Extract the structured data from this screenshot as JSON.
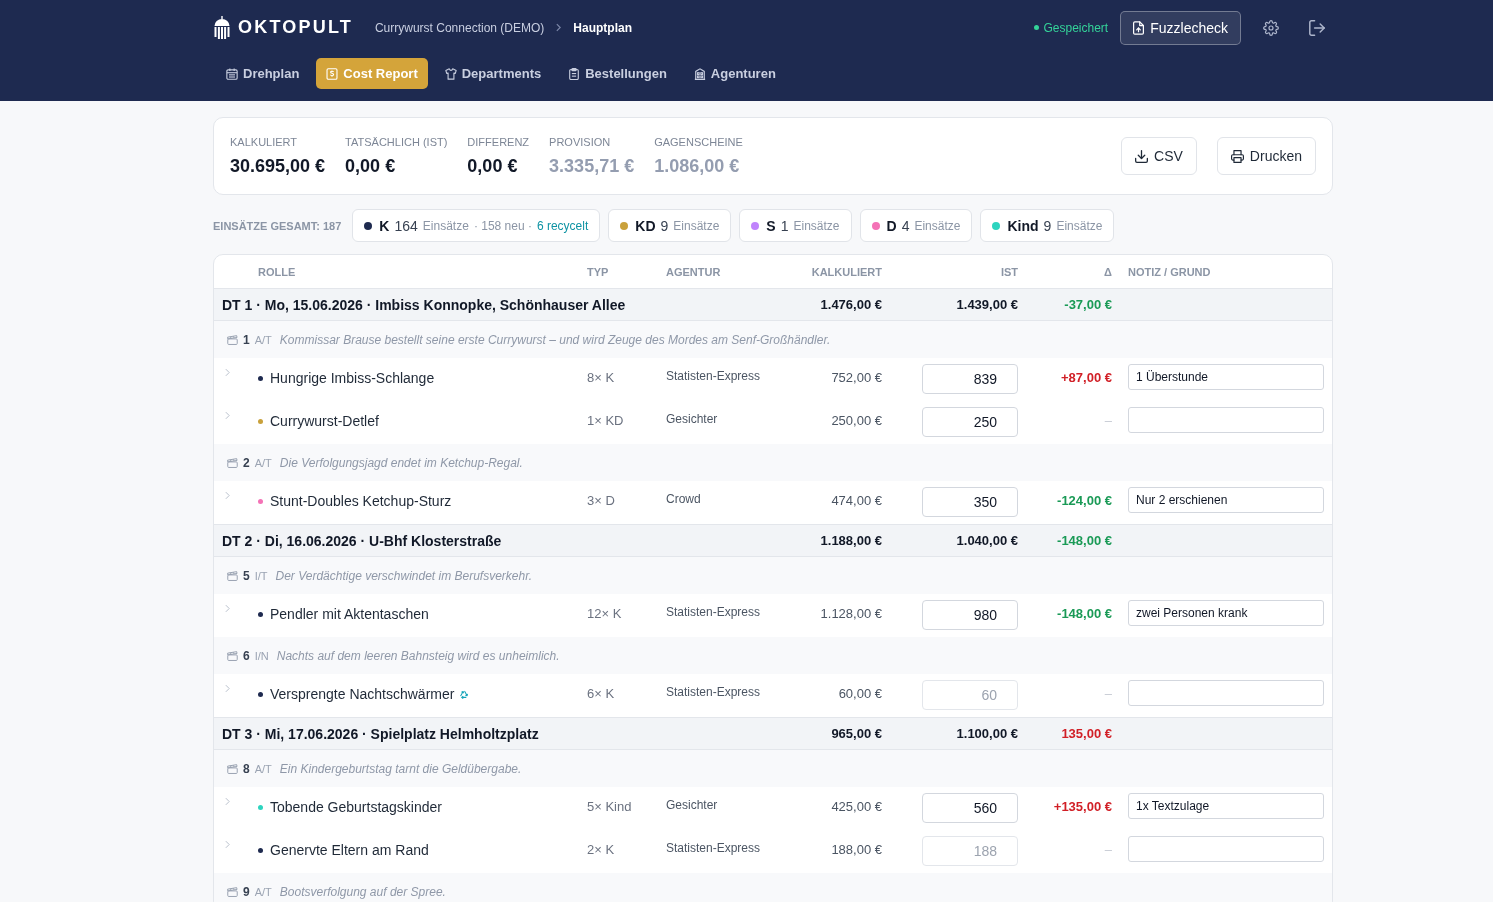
{
  "header": {
    "logo": "OKTOPULT",
    "breadcrumb": [
      {
        "label": "Currywurst Connection (DEMO)",
        "current": false
      },
      {
        "label": "Hauptplan",
        "current": true
      }
    ],
    "save_status": "Gespeichert",
    "action_button": "Fuzzlecheck"
  },
  "nav_tabs": [
    {
      "label": "Drehplan",
      "selected": false
    },
    {
      "label": "Cost Report",
      "selected": true
    },
    {
      "label": "Departments",
      "selected": false
    },
    {
      "label": "Bestellungen",
      "selected": false
    },
    {
      "label": "Agenturen",
      "selected": false
    }
  ],
  "summary": {
    "stats": [
      {
        "label": "KALKULIERT",
        "value": "30.695,00 €",
        "muted": false
      },
      {
        "label": "TATSÄCHLICH (IST)",
        "value": "0,00 €",
        "muted": false
      },
      {
        "label": "DIFFERENZ",
        "value": "0,00 €",
        "muted": false
      },
      {
        "label": "PROVISION",
        "value": "3.335,71 €",
        "muted": true
      },
      {
        "label": "GAGENSCHEINE",
        "value": "1.086,00 €",
        "muted": true
      }
    ],
    "buttons": [
      "CSV",
      "Drucken"
    ]
  },
  "assignments": {
    "label": "EINSÄTZE GESAMT: 187",
    "categories": [
      {
        "code": "K",
        "count": "164",
        "unit": "Einsätze",
        "color": "#1e2a4f",
        "new": "· 158 neu ·",
        "recycled": "6 recycelt"
      },
      {
        "code": "KD",
        "count": "9",
        "unit": "Einsätze",
        "color": "#c9a13b"
      },
      {
        "code": "S",
        "count": "1",
        "unit": "Einsätze",
        "color": "#c084fc"
      },
      {
        "code": "D",
        "count": "4",
        "unit": "Einsätze",
        "color": "#f472b6"
      },
      {
        "code": "Kind",
        "count": "9",
        "unit": "Einsätze",
        "color": "#2dd4bf"
      }
    ]
  },
  "table": {
    "columns": [
      "ROLLE",
      "TYP",
      "AGENTUR",
      "KALKULIERT",
      "IST",
      "Δ",
      "NOTIZ / GRUND"
    ],
    "days": [
      {
        "title": "DT 1 · Mo, 15.06.2026 · Imbiss Konnopke, Schönhauser Allee",
        "calculated": "1.476,00 €",
        "actual": "1.439,00 €",
        "delta": "-37,00 €",
        "kind": "under",
        "scenes": [
          {
            "number": "1",
            "time": "A/T",
            "description": "Kommissar Brause bestellt seine erste Currywurst – und wird Zeuge des Mordes am Senf-Großhändler.",
            "roles": [
              {
                "name": "Hungrige Imbiss-Schlange",
                "color": "#1e2a4f",
                "expanded": false,
                "recycled": false,
                "quantity": "8× K",
                "agency": "Statisten-Express",
                "calculated": "752,00 €",
                "actual": {
                  "value": "839"
                },
                "delta": "+87,00 €",
                "kind": "over",
                "note": "1 Überstunde"
              },
              {
                "name": "Currywurst-Detlef",
                "color": "#c9a13b",
                "expanded": false,
                "recycled": false,
                "quantity": "1× KD",
                "agency": "Gesichter",
                "calculated": "250,00 €",
                "actual": {
                  "value": "250"
                },
                "delta": "–",
                "kind": "none"
              }
            ]
          },
          {
            "number": "2",
            "time": "A/T",
            "description": "Die Verfolgungsjagd endet im Ketchup-Regal.",
            "roles": [
              {
                "name": "Stunt-Doubles Ketchup-Sturz",
                "color": "#f472b6",
                "expanded": false,
                "recycled": false,
                "quantity": "3× D",
                "agency": "Crowd",
                "calculated": "474,00 €",
                "actual": {
                  "value": "350"
                },
                "delta": "-124,00 €",
                "kind": "under",
                "note": "Nur 2 erschienen"
              }
            ]
          }
        ]
      },
      {
        "title": "DT 2 · Di, 16.06.2026 · U-Bhf Klosterstraße",
        "calculated": "1.188,00 €",
        "actual": "1.040,00 €",
        "delta": "-148,00 €",
        "kind": "under",
        "scenes": [
          {
            "number": "5",
            "time": "I/T",
            "description": "Der Verdächtige verschwindet im Berufsverkehr.",
            "roles": [
              {
                "name": "Pendler mit Aktentaschen",
                "color": "#1e2a4f",
                "expanded": false,
                "recycled": false,
                "quantity": "12× K",
                "agency": "Statisten-Express",
                "calculated": "1.128,00 €",
                "actual": {
                  "value": "980"
                },
                "delta": "-148,00 €",
                "kind": "under",
                "note": "zwei Personen krank"
              }
            ]
          },
          {
            "number": "6",
            "time": "I/N",
            "description": "Nachts auf dem leeren Bahnsteig wird es unheimlich.",
            "roles": [
              {
                "name": "Versprengte Nachtschwärmer",
                "color": "#1e2a4f",
                "expanded": false,
                "recycled": true,
                "quantity": "6× K",
                "agency": "Statisten-Express",
                "calculated": "60,00 €",
                "actual": {
                  "placeholder": "60"
                },
                "delta": "–",
                "kind": "none"
              }
            ]
          }
        ]
      },
      {
        "title": "DT 3 · Mi, 17.06.2026 · Spielplatz Helmholtzplatz",
        "calculated": "965,00 €",
        "actual": "1.100,00 €",
        "delta": "135,00 €",
        "kind": "over",
        "scenes": [
          {
            "number": "8",
            "time": "A/T",
            "description": "Ein Kindergeburtstag tarnt die Geldübergabe.",
            "roles": [
              {
                "name": "Tobende Geburtstagskinder",
                "color": "#2dd4bf",
                "expanded": false,
                "recycled": false,
                "quantity": "5× Kind",
                "agency": "Gesichter",
                "calculated": "425,00 €",
                "actual": {
                  "value": "560"
                },
                "delta": "+135,00 €",
                "kind": "over",
                "note": "1x Textzulage"
              },
              {
                "name": "Genervte Eltern am Rand",
                "color": "#1e2a4f",
                "expanded": false,
                "recycled": false,
                "quantity": "2× K",
                "agency": "Statisten-Express",
                "calculated": "188,00 €",
                "actual": {
                  "placeholder": "188"
                },
                "delta": "–",
                "kind": "none"
              }
            ]
          },
          {
            "number": "9",
            "time": "A/T",
            "description": "Bootsverfolgung auf der Spree."
          }
        ]
      }
    ]
  }
}
